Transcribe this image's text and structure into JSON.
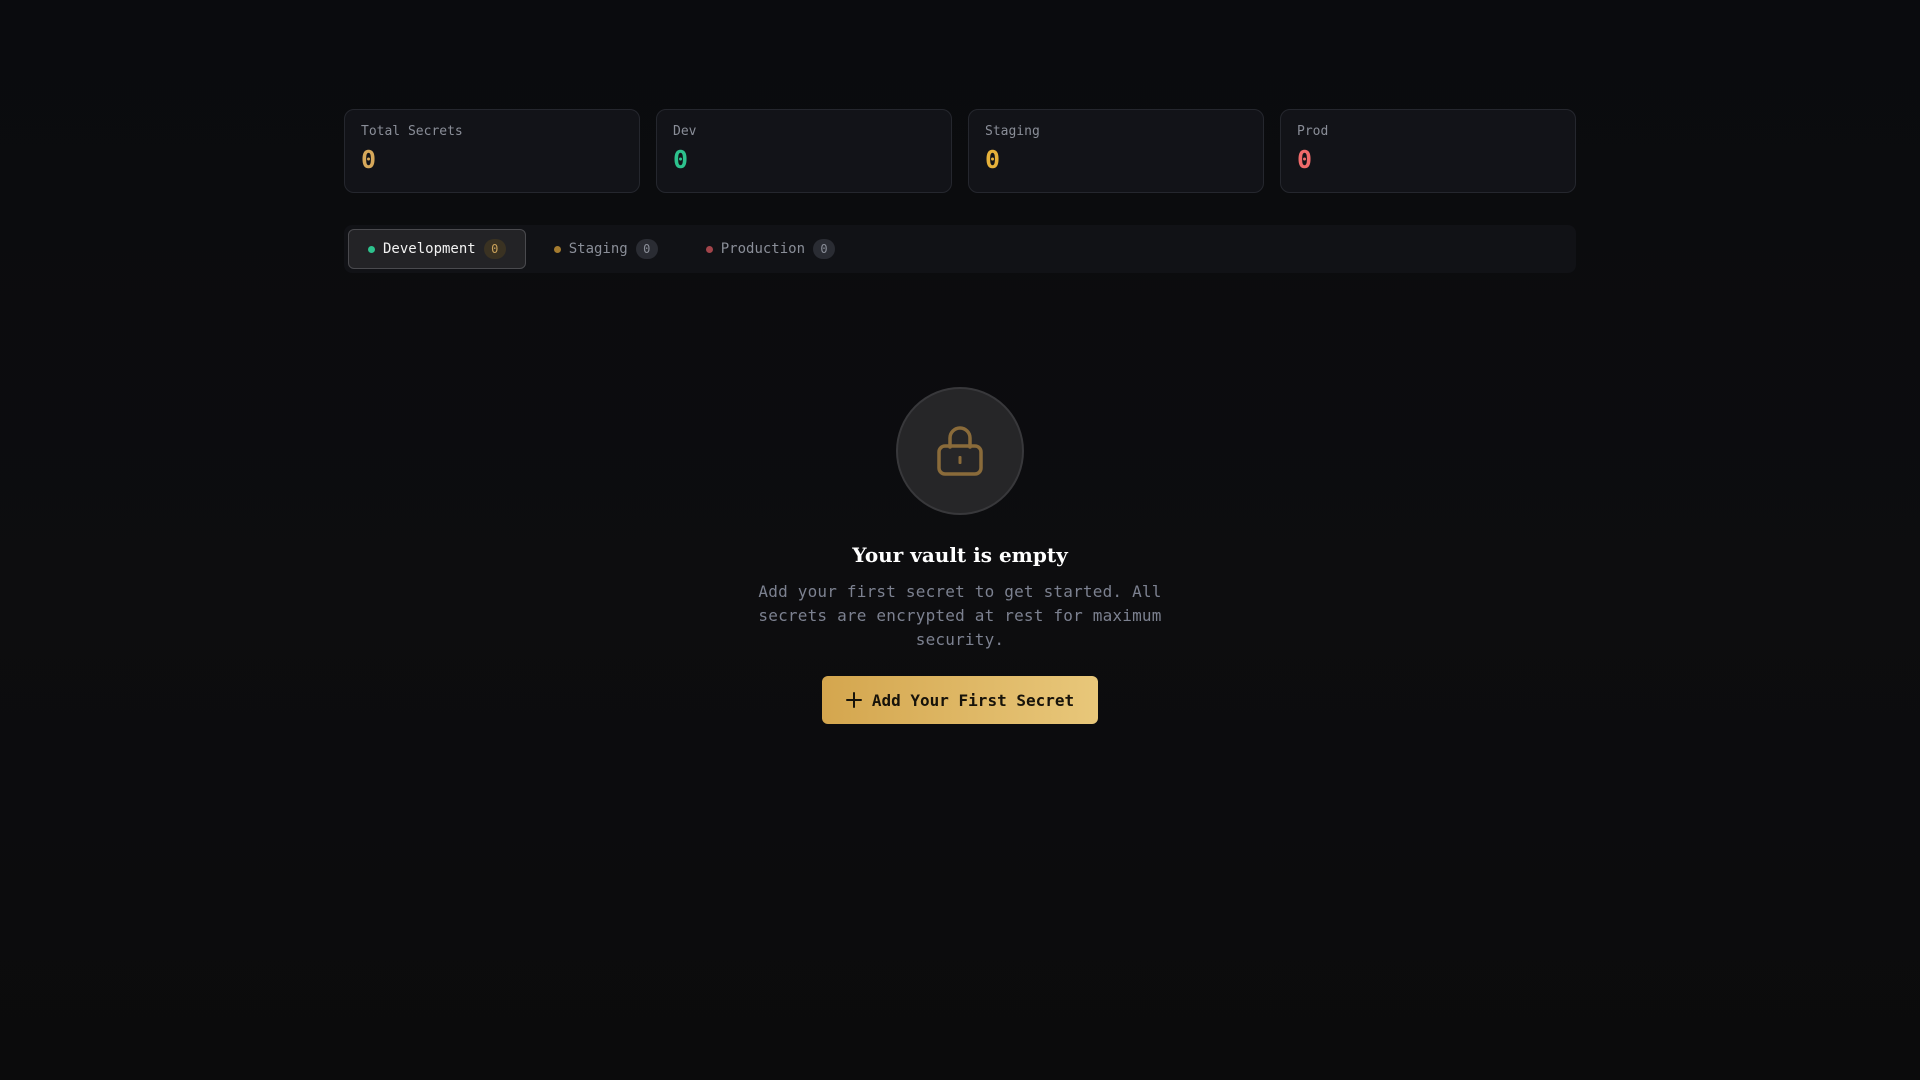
{
  "colors": {
    "total": "#d6a85a",
    "dev": "#2dc28d",
    "staging": "#e6b13a",
    "prod": "#ef6a6a",
    "dot_dev": "#2dc28d",
    "dot_staging": "#a47b2f",
    "dot_prod": "#a2444a",
    "lock_icon": "#8a6b3a",
    "button": "#e0b866"
  },
  "stats": [
    {
      "label": "Total Secrets",
      "value": "0"
    },
    {
      "label": "Dev",
      "value": "0"
    },
    {
      "label": "Staging",
      "value": "0"
    },
    {
      "label": "Prod",
      "value": "0"
    }
  ],
  "tabs": [
    {
      "label": "Development",
      "count": "0",
      "active": true
    },
    {
      "label": "Staging",
      "count": "0",
      "active": false
    },
    {
      "label": "Production",
      "count": "0",
      "active": false
    }
  ],
  "empty_state": {
    "icon": "lock-icon",
    "title": "Your vault is empty",
    "description": "Add your first secret to get started. All secrets are encrypted at rest for maximum security.",
    "button_label": "Add Your First Secret",
    "button_icon": "plus-icon"
  }
}
